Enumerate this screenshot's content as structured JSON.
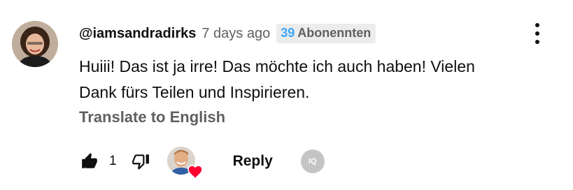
{
  "comment": {
    "author": "@iamsandradirks",
    "time": "7 days ago",
    "badge": {
      "count": "39",
      "label": "Abonennten"
    },
    "text_line1": "Huiii! Das ist ja irre! Das möchte ich auch haben! Vielen",
    "text_line2": "Dank fürs Teilen und Inspirieren.",
    "translate_label": "Translate to English",
    "like_count": "1",
    "reply_label": "Reply",
    "extension_label": "IQ"
  },
  "icons": {
    "avatar": "user-avatar",
    "menu": "more-vert-icon",
    "like": "thumb-up-icon",
    "dislike": "thumb-down-icon",
    "creator_heart": "heart-icon",
    "extension": "iq-badge-icon"
  },
  "colors": {
    "author": "#0f0f0f",
    "secondary_text": "#606060",
    "badge_bg": "#ececec",
    "badge_count": "#3ea6ff",
    "heart": "#ff0033"
  }
}
